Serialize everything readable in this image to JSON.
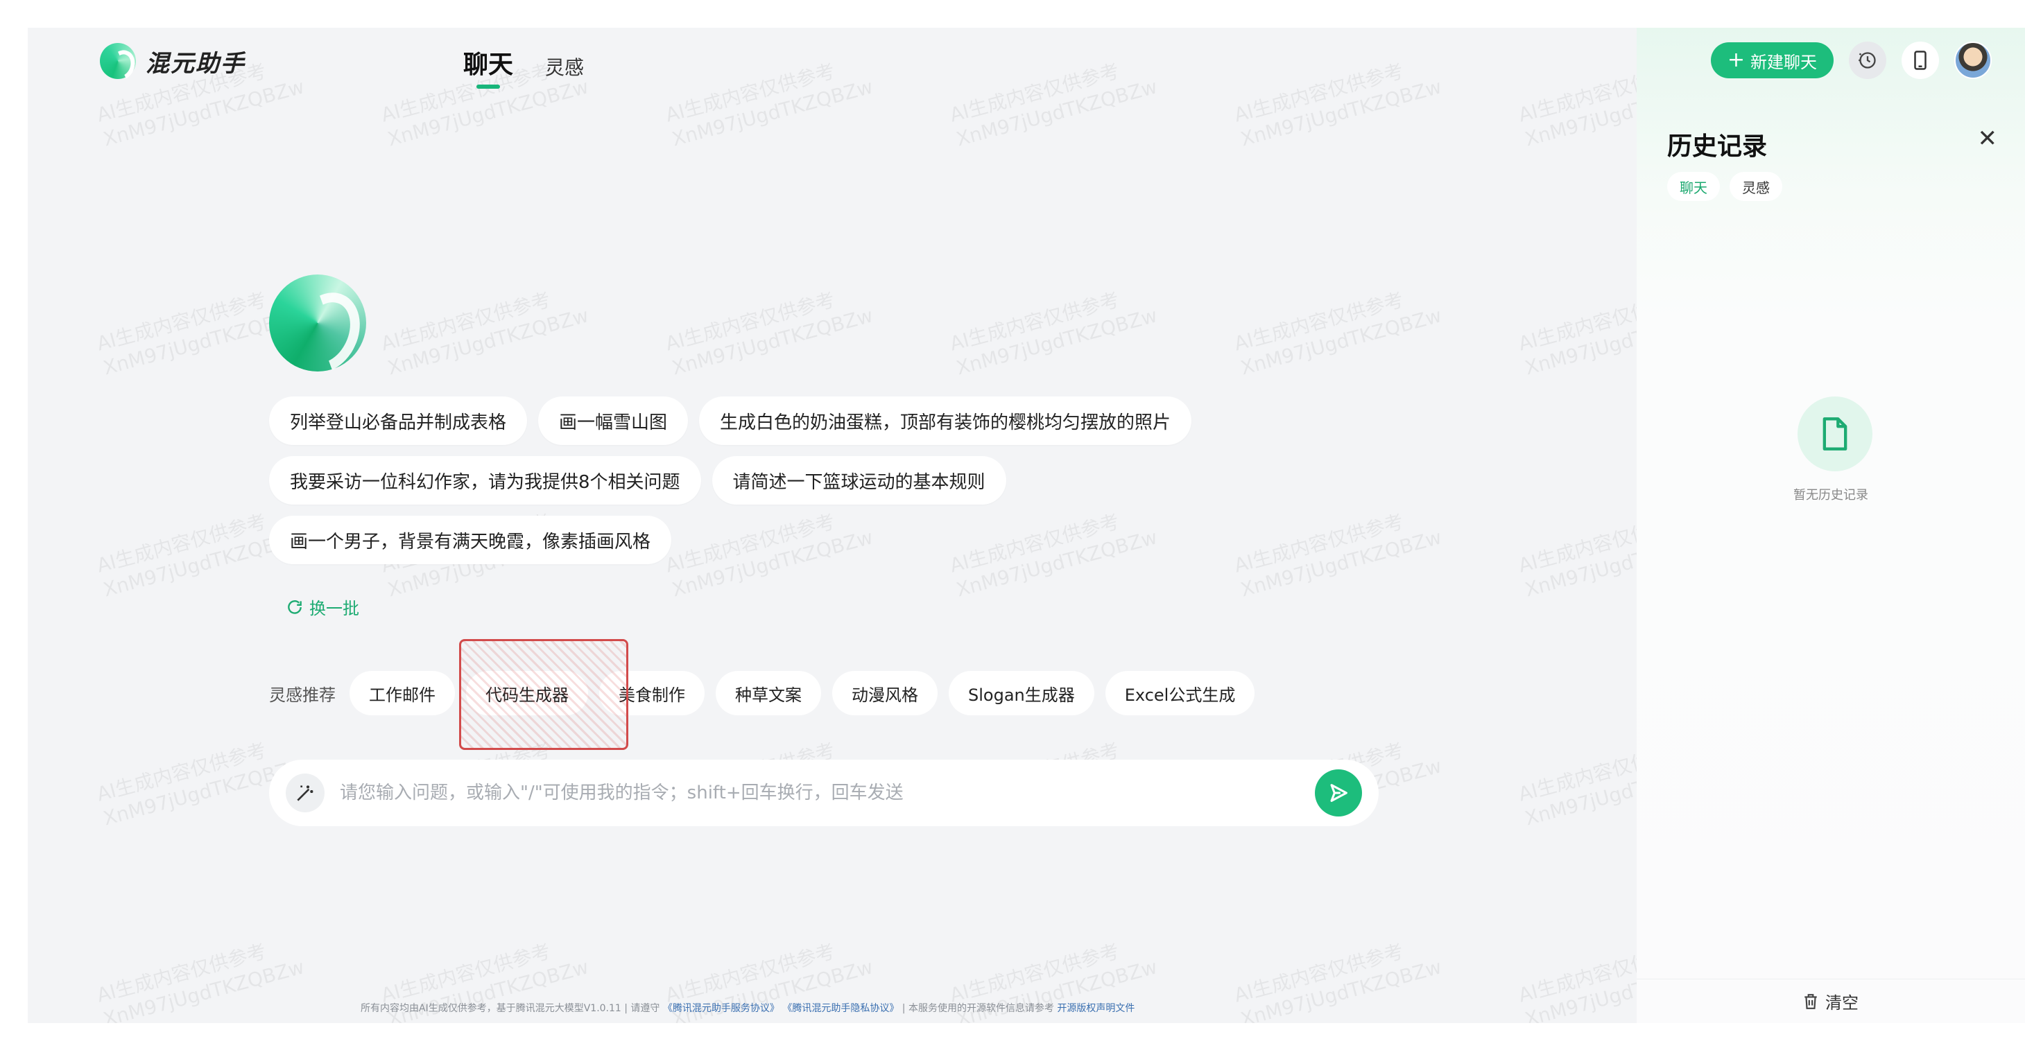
{
  "brand": {
    "name": "混元助手"
  },
  "header": {
    "tabs": [
      {
        "label": "聊天",
        "active": true
      },
      {
        "label": "灵感",
        "active": false
      }
    ],
    "new_chat_label": "新建聊天",
    "icons": [
      "history-clock-icon",
      "mobile-phone-icon",
      "user-avatar"
    ]
  },
  "watermark": {
    "line1": "AI生成内容仅供参考",
    "line2": "XnM97jUgdTKZQBZw"
  },
  "suggestions": [
    [
      "列举登山必备品并制成表格",
      "画一幅雪山图",
      "生成白色的奶油蛋糕，顶部有装饰的樱桃均匀摆放的照片"
    ],
    [
      "我要采访一位科幻作家，请为我提供8个相关问题",
      "请简述一下篮球运动的基本规则"
    ],
    [
      "画一个男子，背景有满天晚霞，像素插画风格"
    ]
  ],
  "refresh_label": "换一批",
  "inspiration": {
    "label": "灵感推荐",
    "items": [
      "工作邮件",
      "代码生成器",
      "美食制作",
      "种草文案",
      "动漫风格",
      "Slogan生成器",
      "Excel公式生成"
    ]
  },
  "input": {
    "placeholder": "请您输入问题，或输入\"/\"可使用我的指令；shift+回车换行，回车发送",
    "value": ""
  },
  "footer": {
    "text1": "所有内容均由AI生成仅供参考，基于腾讯混元大模型V1.0.11 | 请遵守",
    "link1": "《腾讯混元助手服务协议》",
    "link2": "《腾讯混元助手隐私协议》",
    "text2": "| 本服务使用的开源软件信息请参考",
    "link3": "开源版权声明文件"
  },
  "history": {
    "title": "历史记录",
    "tabs": [
      "聊天",
      "灵感"
    ],
    "empty_text": "暂无历史记录",
    "clear_label": "清空"
  },
  "colors": {
    "accent": "#1dbd7c",
    "annotation": "#d24b4b"
  }
}
